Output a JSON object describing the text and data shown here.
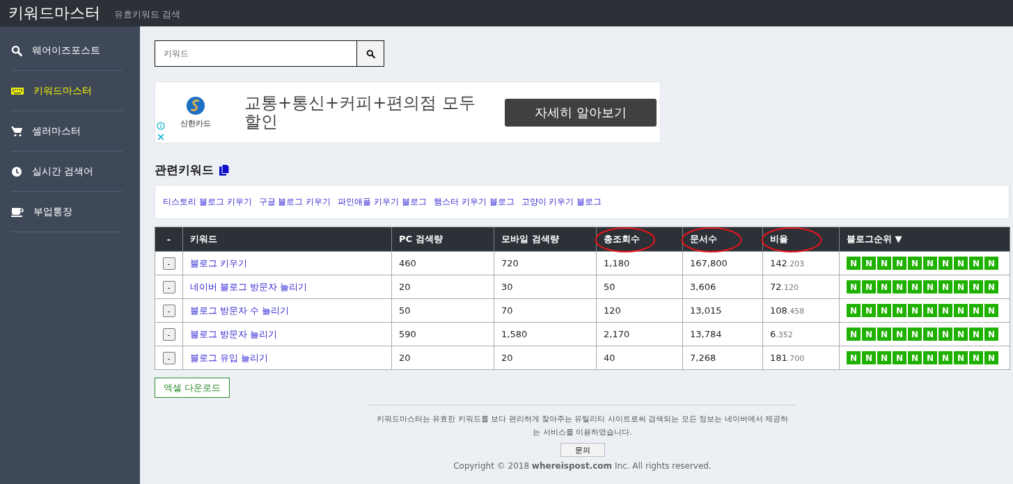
{
  "header": {
    "title": "키워드마스터",
    "subtitle": "유효키워드 검색"
  },
  "sidebar": {
    "items": [
      {
        "label": "웨어이즈포스트",
        "kind": "search",
        "selected": false
      },
      {
        "label": "키워드마스터",
        "kind": "keyboard",
        "selected": true
      },
      {
        "label": "셀러마스터",
        "kind": "cart",
        "selected": false
      },
      {
        "label": "실시간 검색어",
        "kind": "clock",
        "selected": false
      },
      {
        "label": "부업통장",
        "kind": "cup",
        "selected": false
      }
    ]
  },
  "search": {
    "placeholder": "키워드"
  },
  "ad": {
    "brand": "신한카드",
    "headline": "교통+통신+커피+편의점 모두 할인",
    "button": "자세히 알아보기"
  },
  "related": {
    "heading": "관련키워드",
    "keywords": [
      "티스토리 블로그 키우기",
      "구글 블로그 키우기",
      "파인애플 키우기 블로그",
      "햄스터 키우기 블로그",
      "고양이 키우기 블로그"
    ]
  },
  "table": {
    "columns": [
      {
        "label": "-",
        "circled": false
      },
      {
        "label": "키워드",
        "circled": false
      },
      {
        "label": "PC 검색량",
        "circled": false
      },
      {
        "label": "모바일 검색량",
        "circled": false
      },
      {
        "label": "총조회수",
        "circled": true
      },
      {
        "label": "문서수",
        "circled": true
      },
      {
        "label": "비율",
        "circled": true
      },
      {
        "label": "블로그순위 ▼",
        "circled": false
      }
    ],
    "rows": [
      {
        "button": "-",
        "keyword": "블로그 키우기",
        "pc": "460",
        "mobile": "720",
        "total": "1,180",
        "docs": "167,800",
        "ratio_int": "142",
        "ratio_frac": ".203",
        "ranks": [
          "N",
          "N",
          "N",
          "N",
          "N",
          "N",
          "N",
          "N",
          "N",
          "N"
        ]
      },
      {
        "button": "-",
        "keyword": "네이버 블로그 방문자 늘리기",
        "pc": "20",
        "mobile": "30",
        "total": "50",
        "docs": "3,606",
        "ratio_int": "72",
        "ratio_frac": ".120",
        "ranks": [
          "N",
          "N",
          "N",
          "N",
          "N",
          "N",
          "N",
          "N",
          "N",
          "N"
        ]
      },
      {
        "button": "-",
        "keyword": "블로그 방문자 수 늘리기",
        "pc": "50",
        "mobile": "70",
        "total": "120",
        "docs": "13,015",
        "ratio_int": "108",
        "ratio_frac": ".458",
        "ranks": [
          "N",
          "N",
          "N",
          "N",
          "N",
          "N",
          "N",
          "N",
          "N",
          "N"
        ]
      },
      {
        "button": "-",
        "keyword": "블로그 방문자 늘리기",
        "pc": "590",
        "mobile": "1,580",
        "total": "2,170",
        "docs": "13,784",
        "ratio_int": "6",
        "ratio_frac": ".352",
        "ranks": [
          "N",
          "N",
          "N",
          "N",
          "N",
          "N",
          "N",
          "N",
          "N",
          "N"
        ]
      },
      {
        "button": "-",
        "keyword": "블로그 유입 늘리기",
        "pc": "20",
        "mobile": "20",
        "total": "40",
        "docs": "7,268",
        "ratio_int": "181",
        "ratio_frac": ".700",
        "ranks": [
          "N",
          "N",
          "N",
          "N",
          "N",
          "N",
          "N",
          "N",
          "N",
          "N"
        ]
      }
    ]
  },
  "excel_button": "엑셀 다운로드",
  "footer": {
    "notice": "키워드마스터는 유효한 키워드를 보다 편리하게 찾아주는 유틸리티 사이트로써 검색되는 모든 정보는 네이버에서 제공하는 서비스를 이용하였습니다.",
    "contact_button": "문의",
    "copyright": "Copyright © 2018 **whereispost.com** Inc. All rights reserved."
  }
}
